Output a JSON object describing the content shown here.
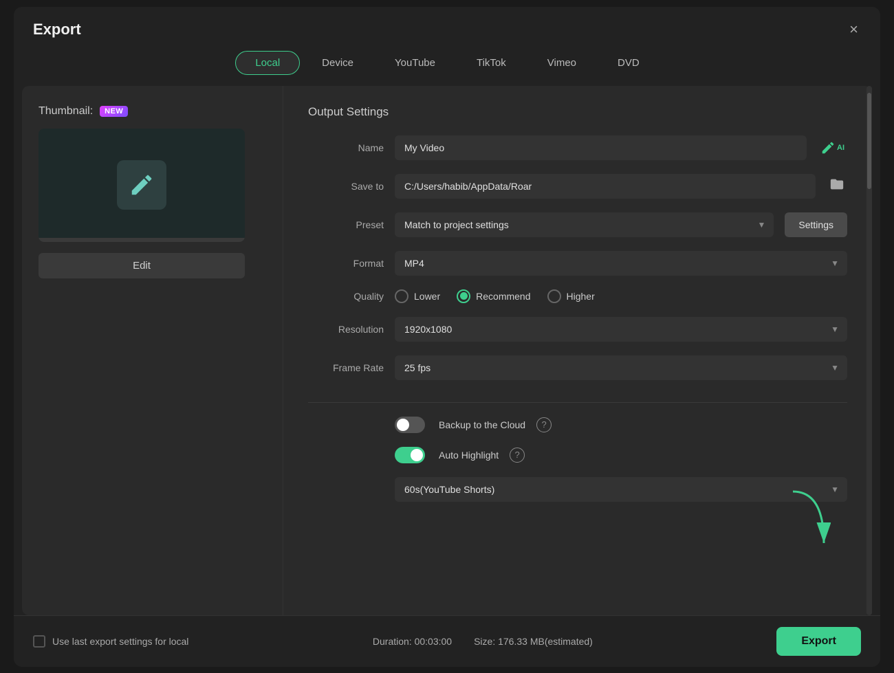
{
  "modal": {
    "title": "Export",
    "close_label": "×"
  },
  "tabs": [
    {
      "id": "local",
      "label": "Local",
      "active": true
    },
    {
      "id": "device",
      "label": "Device",
      "active": false
    },
    {
      "id": "youtube",
      "label": "YouTube",
      "active": false
    },
    {
      "id": "tiktok",
      "label": "TikTok",
      "active": false
    },
    {
      "id": "vimeo",
      "label": "Vimeo",
      "active": false
    },
    {
      "id": "dvd",
      "label": "DVD",
      "active": false
    }
  ],
  "thumbnail": {
    "label": "Thumbnail:",
    "new_badge": "NEW",
    "edit_button": "Edit"
  },
  "output_settings": {
    "title": "Output Settings",
    "name_label": "Name",
    "name_value": "My Video",
    "saveto_label": "Save to",
    "saveto_value": "C:/Users/habib/AppData/Roar",
    "preset_label": "Preset",
    "preset_value": "Match to project settings",
    "settings_button": "Settings",
    "format_label": "Format",
    "format_value": "MP4",
    "quality_label": "Quality",
    "quality_options": [
      {
        "id": "lower",
        "label": "Lower",
        "selected": false
      },
      {
        "id": "recommend",
        "label": "Recommend",
        "selected": true
      },
      {
        "id": "higher",
        "label": "Higher",
        "selected": false
      }
    ],
    "resolution_label": "Resolution",
    "resolution_value": "1920x1080",
    "frame_rate_label": "Frame Rate",
    "frame_rate_value": "25 fps",
    "backup_label": "Backup to the Cloud",
    "backup_enabled": false,
    "auto_highlight_label": "Auto Highlight",
    "auto_highlight_enabled": true,
    "auto_highlight_dropdown": "60s(YouTube Shorts)"
  },
  "footer": {
    "checkbox_label": "Use last export settings for local",
    "duration_label": "Duration: 00:03:00",
    "size_label": "Size: 176.33 MB(estimated)",
    "export_button": "Export"
  }
}
